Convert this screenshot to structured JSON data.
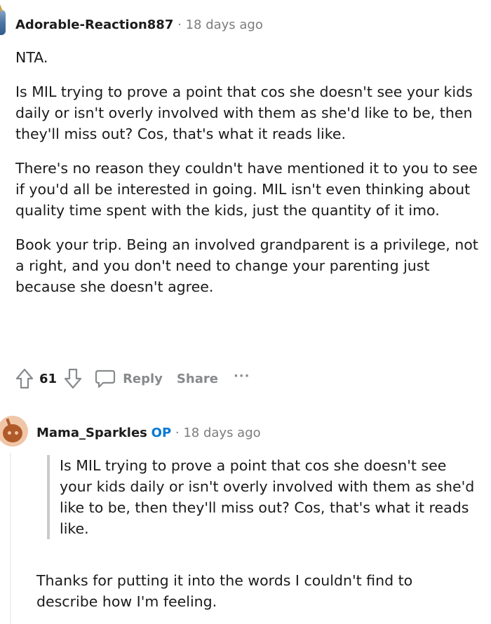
{
  "comment1": {
    "author": "Adorable-Reaction887",
    "separator": "·",
    "time": "18 days ago",
    "paragraphs": [
      "NTA.",
      "Is MIL trying to prove a point that cos she doesn't see your kids daily or isn't overly involved with them as she'd like to be, then they'll miss out? Cos, that's what it reads like.",
      "There's no reason they couldn't have mentioned it to you to see if you'd all be interested in going. MIL isn't even thinking about quality time spent with the kids, just the quantity of it imo.",
      "Book your trip. Being an involved grandparent is a privilege, not a right, and you don't need to change your parenting just because she doesn't agree."
    ],
    "actions": {
      "vote_count": "61",
      "reply_label": "Reply",
      "share_label": "Share",
      "more_label": "···"
    }
  },
  "comment2": {
    "author": "Mama_Sparkles",
    "op_badge": "OP",
    "separator": "·",
    "time": "18 days ago",
    "quote": "Is MIL trying to prove a point that cos she doesn't see your kids daily or isn't overly involved with them as she'd like to be, then they'll miss out? Cos, that's what it reads like.",
    "body": "Thanks for putting it into the words I couldn't find to describe how I'm feeling."
  }
}
